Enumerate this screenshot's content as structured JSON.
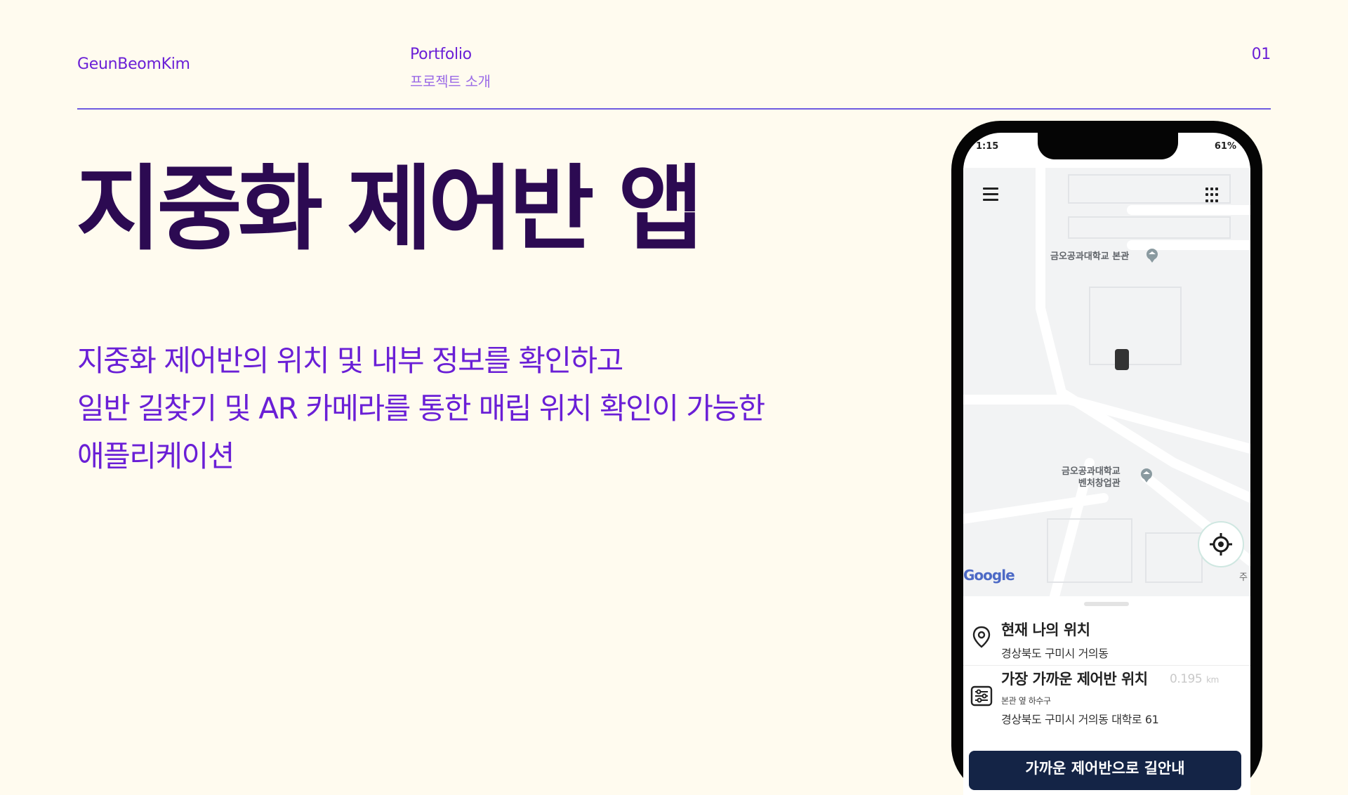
{
  "header": {
    "author": "GeunBeomKim",
    "title": "Portfolio",
    "subtitle": "프로젝트 소개",
    "page_number": "01"
  },
  "main": {
    "headline": "지중화 제어반 앱",
    "description": [
      "지중화 제어반의 위치 및 내부 정보를 확인하고",
      "일반 길찾기 및 AR 카메라를 통한 매립 위치 확인이 가능한",
      "애플리케이션"
    ]
  },
  "phone": {
    "status_time": "1:15",
    "status_right": "61%",
    "map": {
      "poi_1": "금오공과대학교 본관",
      "poi_2_line1": "금오공과대학교",
      "poi_2_line2": "벤처창업관",
      "google_logo": "Google",
      "map_edge_text": "주"
    },
    "sheet": {
      "current_title": "현재 나의 위치",
      "current_address": "경상북도 구미시 거의동",
      "nearest_title": "가장 가까운 제어반 위치",
      "nearest_distance": "0.195",
      "distance_unit": "km",
      "nearest_note": "본관 옆 하수구",
      "nearest_address": "경상북도 구미시 거의동 대학로 61",
      "navigate_button": "가까운 제어반으로 길안내"
    }
  },
  "colors": {
    "background": "#fffbef",
    "accent": "#6a1fd6",
    "headline": "#2c0a52",
    "rule": "#6f5be0",
    "button": "#142446"
  }
}
